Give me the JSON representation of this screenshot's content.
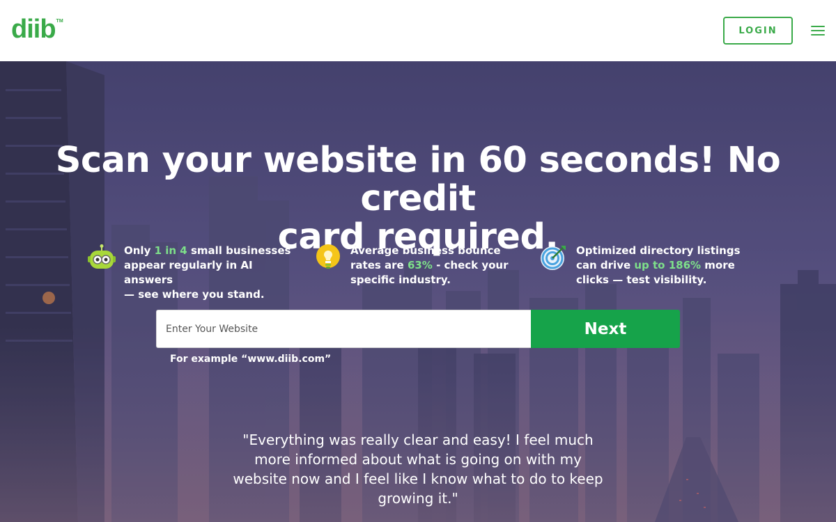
{
  "header": {
    "logo_text": "diib",
    "logo_tm": "TM",
    "login_label": "LOGIN",
    "menu_icon": "hamburger-menu-icon",
    "brand_color": "#3aaa49"
  },
  "hero": {
    "headline_line1": "Scan your website in 60 seconds! No credit",
    "headline_line2": "card required.",
    "features": [
      {
        "icon": "robot-icon",
        "pre1": "Only ",
        "highlight": "1 in 4",
        "post1": " small businesses",
        "line2": "appear regularly in AI answers",
        "line3": "— see where you stand."
      },
      {
        "icon": "lightbulb-icon",
        "line1": "Average business bounce",
        "pre2": "rates are ",
        "highlight": "63%",
        "post2": " - check your",
        "line3": "specific industry."
      },
      {
        "icon": "target-icon",
        "line1": "Optimized directory listings",
        "pre2": "can drive ",
        "highlight": "up to 186%",
        "post2": " more",
        "line3": "clicks — test visibility."
      }
    ],
    "input_placeholder": "Enter Your Website",
    "next_label": "Next",
    "example_text": "For example “www.diib.com”",
    "quote": "\"Everything was really clear and easy! I feel much more informed about what is going on with my website now and I feel like I know what to do to keep growing it.\"",
    "highlight_color": "#7ee08a",
    "button_color": "#16a34a"
  }
}
